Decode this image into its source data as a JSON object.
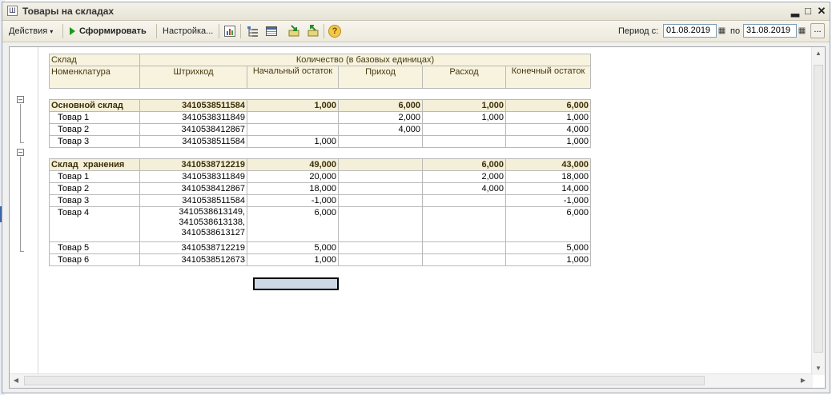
{
  "window": {
    "title": "Товары на складах",
    "icon_glyph": "Ш"
  },
  "toolbar": {
    "actions_label": "Действия",
    "generate_label": "Сформировать",
    "settings_label": "Настройка...",
    "period_label": "Период с:",
    "date_from": "01.08.2019",
    "to_label": "по",
    "date_to": "31.08.2019",
    "dots_label": "...",
    "help_glyph": "?"
  },
  "report": {
    "headers": {
      "warehouse": "Склад",
      "nomenclature": "Номенклатура",
      "barcode": "Штрихкод",
      "quantity": "Количество (в базовых единицах)",
      "start": "Начальный остаток",
      "income": "Приход",
      "expense": "Расход",
      "end": "Конечный остаток"
    },
    "groups": [
      {
        "name": "Основной склад",
        "barcode": "3410538511584",
        "start": "1,000",
        "income": "6,000",
        "expense": "1,000",
        "end": "6,000",
        "items": [
          {
            "name": "Товар 1",
            "barcode": "3410538311849",
            "start": "",
            "income": "2,000",
            "expense": "1,000",
            "end": "1,000"
          },
          {
            "name": "Товар 2",
            "barcode": "3410538412867",
            "start": "",
            "income": "4,000",
            "expense": "",
            "end": "4,000"
          },
          {
            "name": "Товар 3",
            "barcode": "3410538511584",
            "start": "1,000",
            "income": "",
            "expense": "",
            "end": "1,000"
          }
        ]
      },
      {
        "name": "Склад  хранения",
        "barcode": "3410538712219",
        "start": "49,000",
        "income": "",
        "expense": "6,000",
        "end": "43,000",
        "items": [
          {
            "name": "Товар 1",
            "barcode": "3410538311849",
            "start": "20,000",
            "income": "",
            "expense": "2,000",
            "end": "18,000"
          },
          {
            "name": "Товар 2",
            "barcode": "3410538412867",
            "start": "18,000",
            "income": "",
            "expense": "4,000",
            "end": "14,000"
          },
          {
            "name": "Товар 3",
            "barcode": "3410538511584",
            "start": "-1,000",
            "income": "",
            "expense": "",
            "end": "-1,000"
          },
          {
            "name": "Товар 4",
            "barcode_lines": [
              "3410538613149,",
              "3410538613138,",
              "3410538613127"
            ],
            "start": "6,000",
            "income": "",
            "expense": "",
            "end": "6,000"
          },
          {
            "name": "Товар 5",
            "barcode": "3410538712219",
            "start": "5,000",
            "income": "",
            "expense": "",
            "end": "5,000"
          },
          {
            "name": "Товар 6",
            "barcode": "3410538512673",
            "start": "1,000",
            "income": "",
            "expense": "",
            "end": "1,000"
          }
        ]
      }
    ]
  }
}
